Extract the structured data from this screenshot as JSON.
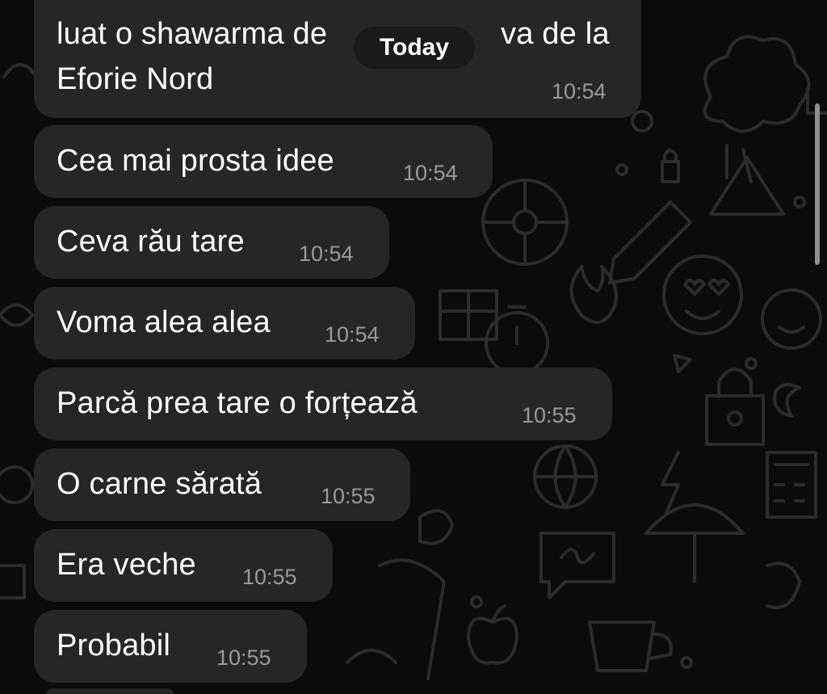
{
  "chat": {
    "day_separator": "Today",
    "messages": [
      {
        "lines": [
          "luat o shawarma de",
          "Eforie Nord"
        ],
        "hidden_tail": "va de la",
        "time": "10:54"
      },
      {
        "lines": [
          "Cea mai prosta idee"
        ],
        "time": "10:54"
      },
      {
        "lines": [
          "Ceva rău tare"
        ],
        "time": "10:54"
      },
      {
        "lines": [
          "Voma alea alea"
        ],
        "time": "10:54"
      },
      {
        "lines": [
          "Parcă prea tare o forțează"
        ],
        "time": "10:55"
      },
      {
        "lines": [
          "O carne sărată"
        ],
        "time": "10:55"
      },
      {
        "lines": [
          "Era veche"
        ],
        "time": "10:55"
      },
      {
        "lines": [
          "Probabil"
        ],
        "time": "10:55"
      }
    ]
  },
  "colors": {
    "background": "#0b0b0b",
    "bubble": "#262628",
    "text": "#ffffff",
    "timestamp": "#9a9a9c",
    "wallpaper_doodle": "#2a2a2a"
  }
}
